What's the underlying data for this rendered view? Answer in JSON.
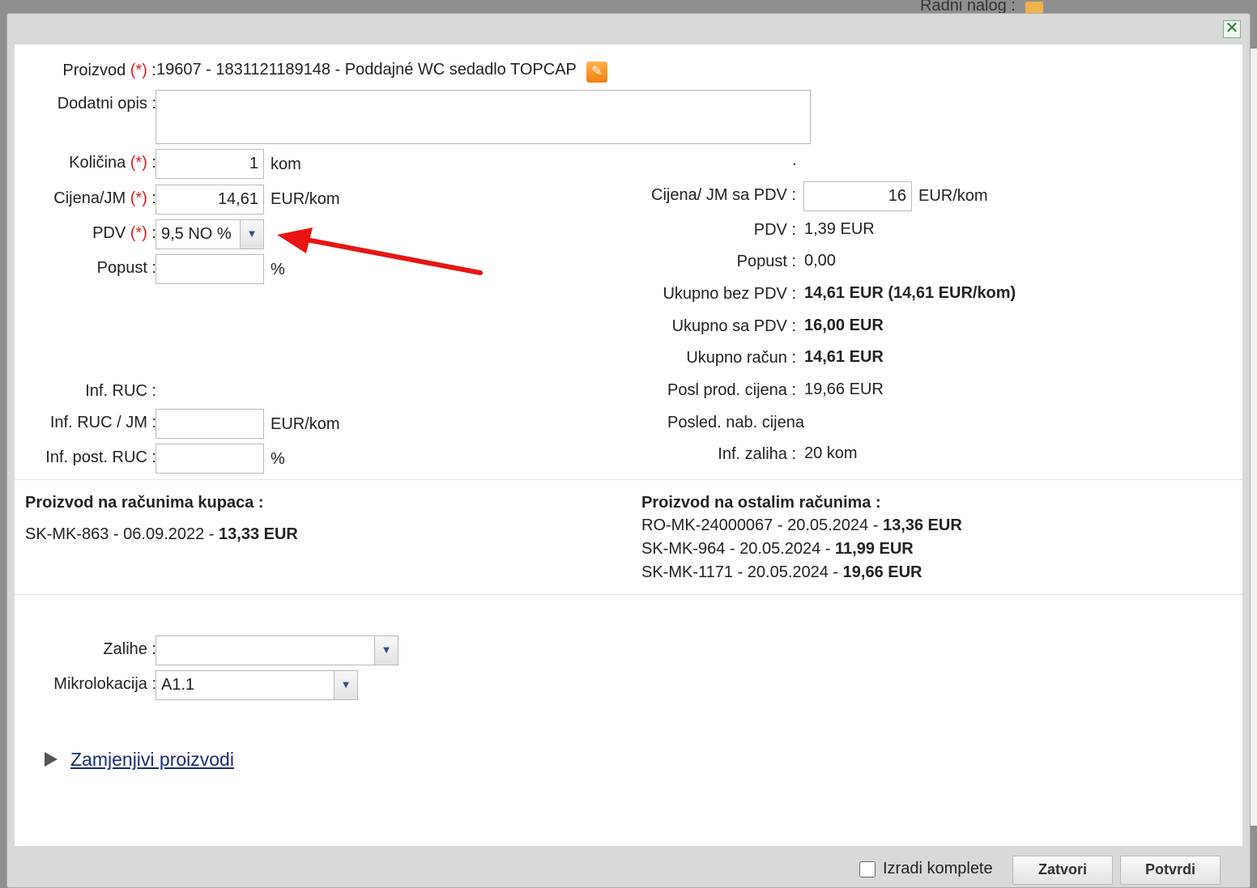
{
  "background": {
    "title": "Radni nalog :"
  },
  "product": {
    "label": "Proizvod",
    "required_mark": "(*)",
    "value": "19607 - 1831121189148 - Poddajné WC sedadlo TOPCAP"
  },
  "extra_desc": {
    "label": "Dodatni opis :",
    "value": ""
  },
  "quantity": {
    "label": "Količina",
    "required_mark": "(*)",
    "value": "1",
    "unit": "kom"
  },
  "unit_price": {
    "label": "Cijena/JM",
    "required_mark": "(*)",
    "value": "14,61",
    "unit": "EUR/kom"
  },
  "vat": {
    "label": "PDV",
    "required_mark": "(*)",
    "selected": "9,5 NO %"
  },
  "discount": {
    "label": "Popust :",
    "value": "",
    "unit": "%"
  },
  "ruc": {
    "label": "Inf. RUC :",
    "per_unit_label": "Inf. RUC / JM :",
    "per_unit_value": "",
    "per_unit_unit": "EUR/kom",
    "post_label": "Inf. post. RUC :",
    "post_value": "",
    "post_unit": "%"
  },
  "right_col": {
    "dot": ".",
    "price_vat_label": "Cijena/ JM sa PDV :",
    "price_vat_value": "16",
    "price_vat_unit": "EUR/kom",
    "vat_label": "PDV :",
    "vat_value": "1,39 EUR",
    "discount_label": "Popust :",
    "discount_value": "0,00",
    "total_no_vat_label": "Ukupno bez PDV :",
    "total_no_vat_value": "14,61 EUR (14,61 EUR/kom)",
    "total_vat_label": "Ukupno sa PDV :",
    "total_vat_value": "16,00 EUR",
    "total_invoice_label": "Ukupno račun :",
    "total_invoice_value": "14,61 EUR",
    "last_sale_label": "Posl prod. cijena :",
    "last_sale_value": "19,66 EUR",
    "last_purchase_label": "Posled. nab. cijena",
    "stock_label": "Inf. zaliha :",
    "stock_value": "20 kom"
  },
  "customer_invoices": {
    "heading": "Proizvod na računima kupaca :",
    "items": [
      {
        "ref": "SK-MK-863 - 06.09.2022 - ",
        "amount": "13,33 EUR"
      }
    ]
  },
  "other_invoices": {
    "heading": "Proizvod na ostalim računima :",
    "items": [
      {
        "ref": "RO-MK-24000067 - 20.05.2024 - ",
        "amount": "13,36 EUR"
      },
      {
        "ref": "SK-MK-964 - 20.05.2024 - ",
        "amount": "11,99 EUR"
      },
      {
        "ref": "SK-MK-1171 - 20.05.2024 - ",
        "amount": "19,66 EUR"
      }
    ]
  },
  "stock": {
    "label": "Zalihe :",
    "selected": ""
  },
  "microlocation": {
    "label": "Mikrolokacija :",
    "selected": "A1.1"
  },
  "replaceable_link": "Zamjenjivi proizvodi",
  "footer": {
    "make_sets_label": "Izradi komplete",
    "make_sets_checked": false,
    "close_label": "Zatvori",
    "confirm_label": "Potvrdi"
  },
  "colors": {
    "annotation_arrow": "#e81515",
    "required": "#e02020",
    "link": "#1a2a7a"
  }
}
